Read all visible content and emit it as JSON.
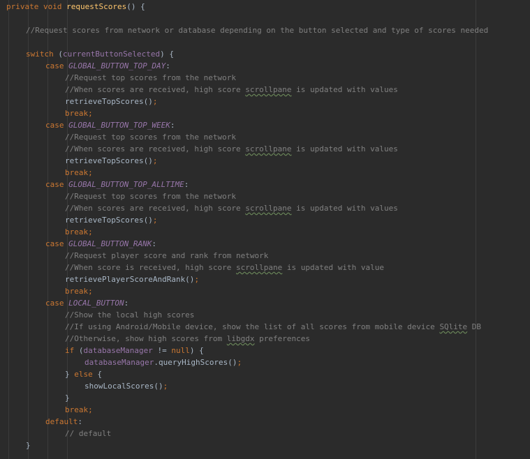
{
  "code": {
    "l1_kw1": "private",
    "l1_kw2": "void",
    "l1_fn": "requestScores",
    "l1_rest": "() {",
    "l3_comment": "//Request scores from network or database depending on the button selected and type of scores needed",
    "l5_kw": "switch",
    "l5_p1": " (",
    "l5_var": "currentButtonSelected",
    "l5_p2": ") {",
    "case_kw": "case",
    "c1_const": "GLOBAL_BUTTON_TOP_DAY",
    "c2_const": "GLOBAL_BUTTON_TOP_WEEK",
    "c3_const": "GLOBAL_BUTTON_TOP_ALLTIME",
    "c4_const": "GLOBAL_BUTTON_RANK",
    "c5_const": "LOCAL_BUTTON",
    "colon": ":",
    "cm_top": "//Request top scores from the network",
    "cm_when_a": "//When scores are received, high score ",
    "cm_scrollpane": "scrollpane",
    "cm_when_b": " is updated with values",
    "call_top": "retrieveTopScores()",
    "semi": ";",
    "break_kw": "break;",
    "cm_player": "//Request player score and rank from network",
    "cm_when2_a": "//When score is received, high score ",
    "cm_when2_b": " is updated with value",
    "call_player": "retrievePlayerScoreAndRank()",
    "cm_local": "//Show the local high scores",
    "cm_android_a": "//If using Android/Mobile device, show the list of all scores from mobile device ",
    "cm_sqlite": "SQlite",
    "cm_android_b": " DB",
    "cm_other_a": "//Otherwise, show high scores from ",
    "cm_libgdx": "libgdx",
    "cm_other_b": " preferences",
    "if_kw": "if",
    "if_p1": " (",
    "db_field": "databaseManager",
    "if_op": " != ",
    "null_kw": "null",
    "if_p2": ") {",
    "db_dot": ".queryHighScores()",
    "else_open": "} ",
    "else_kw": "else",
    "else_close": " {",
    "call_local": "showLocalScores()",
    "close_brace": "}",
    "default_kw": "default",
    "cm_default": "// default"
  }
}
